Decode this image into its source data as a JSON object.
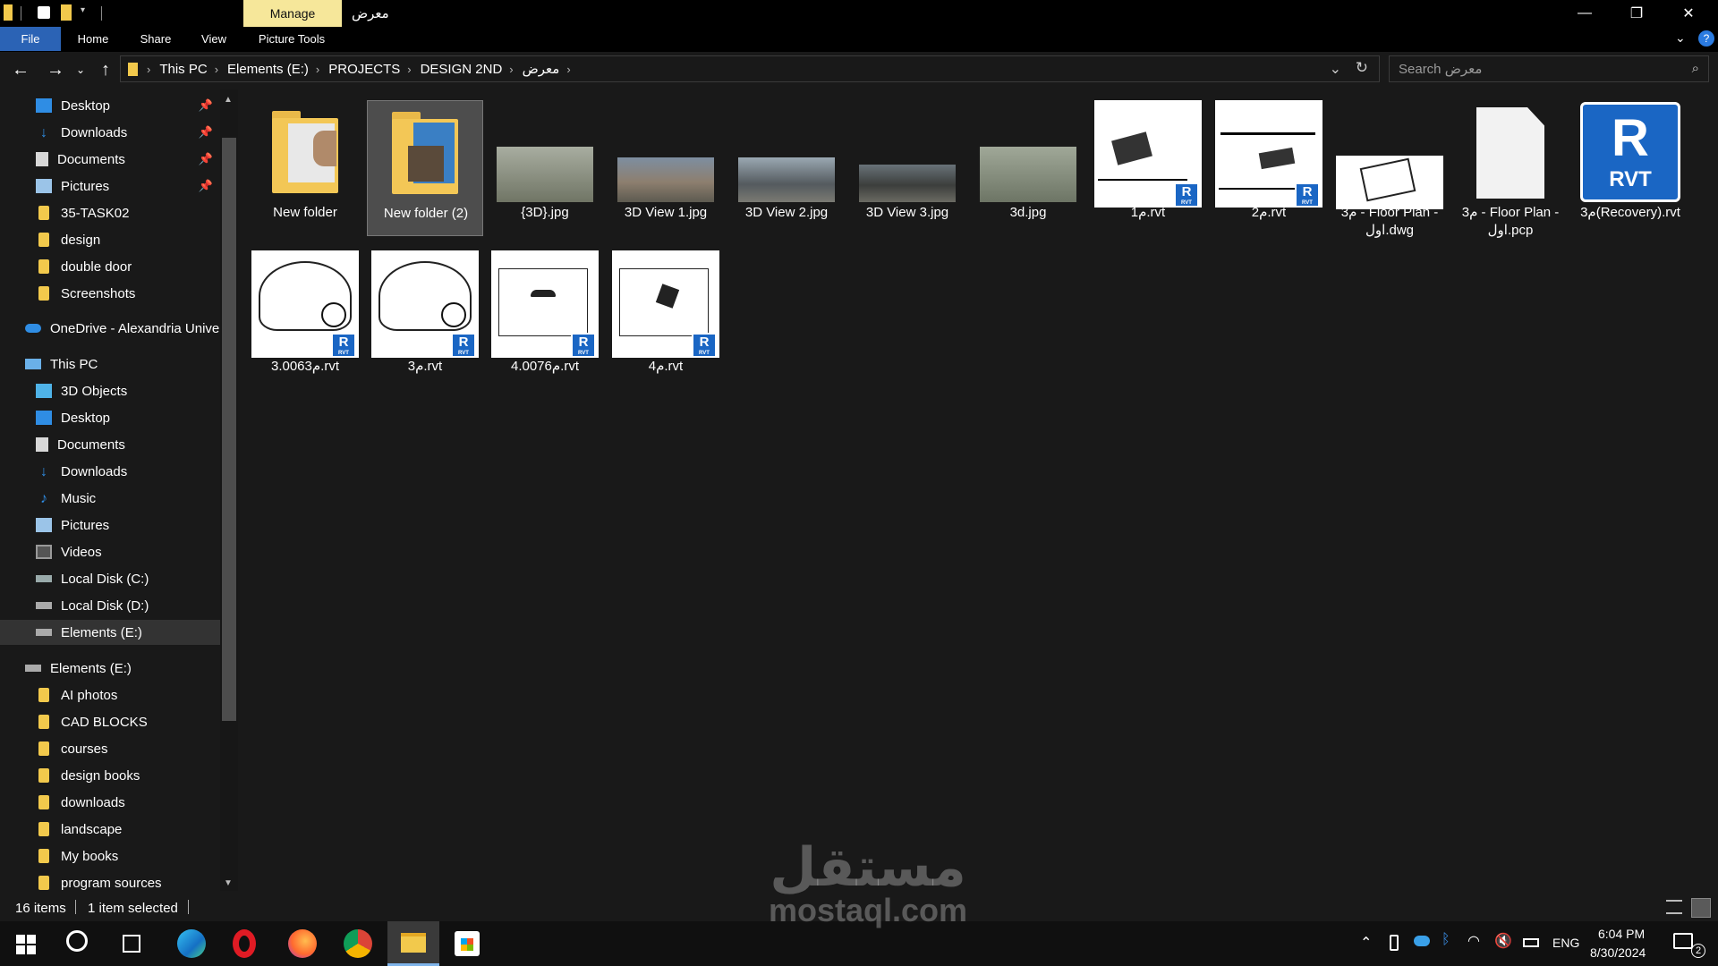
{
  "window": {
    "title": "معرض",
    "context_tab": "Manage",
    "minimize": "—",
    "maximize": "❐",
    "close": "✕"
  },
  "ribbon": {
    "tabs": [
      "File",
      "Home",
      "Share",
      "View",
      "Picture Tools"
    ],
    "help": "?"
  },
  "address": {
    "crumbs": [
      "This PC",
      "Elements (E:)",
      "PROJECTS",
      "DESIGN 2ND",
      "معرض"
    ],
    "search_placeholder": "Search معرض"
  },
  "nav": {
    "quick_access": [
      {
        "label": "Desktop",
        "icon": "desktop-icon",
        "pinned": true
      },
      {
        "label": "Downloads",
        "icon": "downloads-icon",
        "pinned": true
      },
      {
        "label": "Documents",
        "icon": "documents-icon",
        "pinned": true
      },
      {
        "label": "Pictures",
        "icon": "pictures-icon",
        "pinned": true
      },
      {
        "label": "35-TASK02",
        "icon": "folder-icon",
        "pinned": false
      },
      {
        "label": "design",
        "icon": "folder-icon",
        "pinned": false
      },
      {
        "label": "double door",
        "icon": "folder-icon",
        "pinned": false
      },
      {
        "label": "Screenshots",
        "icon": "folder-icon",
        "pinned": false
      }
    ],
    "onedrive": "OneDrive - Alexandria Univer",
    "this_pc": "This PC",
    "this_pc_items": [
      {
        "label": "3D Objects",
        "icon": "3d-objects-icon"
      },
      {
        "label": "Desktop",
        "icon": "desktop-icon"
      },
      {
        "label": "Documents",
        "icon": "documents-icon"
      },
      {
        "label": "Downloads",
        "icon": "downloads-icon"
      },
      {
        "label": "Music",
        "icon": "music-icon"
      },
      {
        "label": "Pictures",
        "icon": "pictures-icon"
      },
      {
        "label": "Videos",
        "icon": "videos-icon"
      },
      {
        "label": "Local Disk (C:)",
        "icon": "drive-icon"
      },
      {
        "label": "Local Disk (D:)",
        "icon": "drive-icon"
      },
      {
        "label": "Elements (E:)",
        "icon": "drive-icon"
      }
    ],
    "drive_e": "Elements (E:)",
    "drive_e_items": [
      "AI photos",
      "CAD BLOCKS",
      "courses",
      "design books",
      "downloads",
      "landscape",
      "My books",
      "program sources"
    ]
  },
  "files": [
    {
      "name": "New folder",
      "kind": "folder",
      "selected": false
    },
    {
      "name": "New folder (2)",
      "kind": "folder",
      "selected": true
    },
    {
      "name": "{3D}.jpg",
      "kind": "image"
    },
    {
      "name": "3D View 1.jpg",
      "kind": "image"
    },
    {
      "name": "3D View 2.jpg",
      "kind": "image"
    },
    {
      "name": "3D View 3.jpg",
      "kind": "image"
    },
    {
      "name": "3d.jpg",
      "kind": "image"
    },
    {
      "name": "م1.rvt",
      "kind": "rvt"
    },
    {
      "name": "م2.rvt",
      "kind": "rvt"
    },
    {
      "name": "م3 - Floor Plan - اول.dwg",
      "kind": "dwg"
    },
    {
      "name": "م3 - Floor Plan - اول.pcp",
      "kind": "blank"
    },
    {
      "name": "م3(Recovery).rvt",
      "kind": "rvt-icon"
    },
    {
      "name": "م3.0063.rvt",
      "kind": "rvt"
    },
    {
      "name": "م3.rvt",
      "kind": "rvt"
    },
    {
      "name": "م4.0076.rvt",
      "kind": "rvt"
    },
    {
      "name": "م4.rvt",
      "kind": "rvt"
    }
  ],
  "rvt_badge": {
    "letter": "R",
    "sub": "RVT"
  },
  "rvt_big_icon": {
    "letter": "R",
    "text": "RVT"
  },
  "status": {
    "items": "16 items",
    "selected": "1 item selected"
  },
  "taskbar": {
    "time": "6:04 PM",
    "date": "8/30/2024",
    "lang": "ENG",
    "notifications": "2"
  },
  "watermark": {
    "arabic": "مستقل",
    "latin": "mostaql.com"
  },
  "colors": {
    "accent": "#2b63b5",
    "folder": "#f2c94c",
    "manage_tab": "#f6e79a",
    "revit_blue": "#1a66c4"
  }
}
